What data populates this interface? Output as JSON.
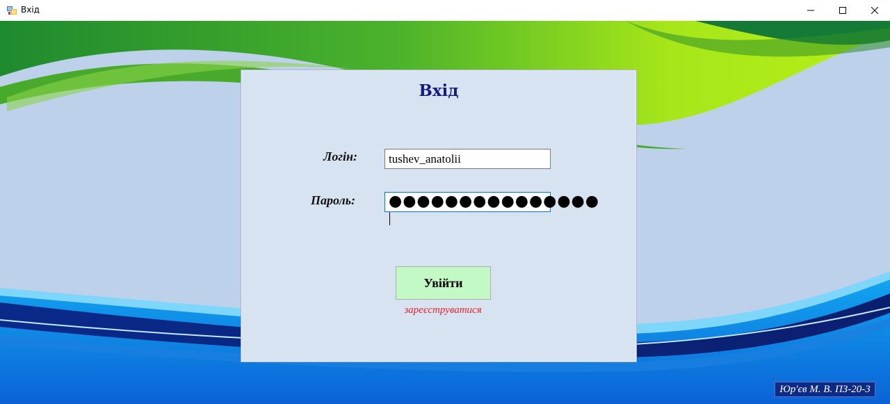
{
  "window": {
    "title": "Вхід"
  },
  "form": {
    "title": "Вхід",
    "login_label": "Логін:",
    "login_value": "tushev_anatolii",
    "password_label": "Пароль:",
    "password_masked": "●●●●●●●●●●●●●●●",
    "enter_button": "Увійти",
    "register_link": "зареєструватися"
  },
  "footer": {
    "author": "Юр'єв М. В. ПЗ-20-3"
  },
  "colors": {
    "panel_bg": "#d7e3f1",
    "title_color": "#151d7c",
    "button_bg": "#c2f9c5",
    "link_color": "#e8232c",
    "author_bg": "#0d2a86"
  }
}
